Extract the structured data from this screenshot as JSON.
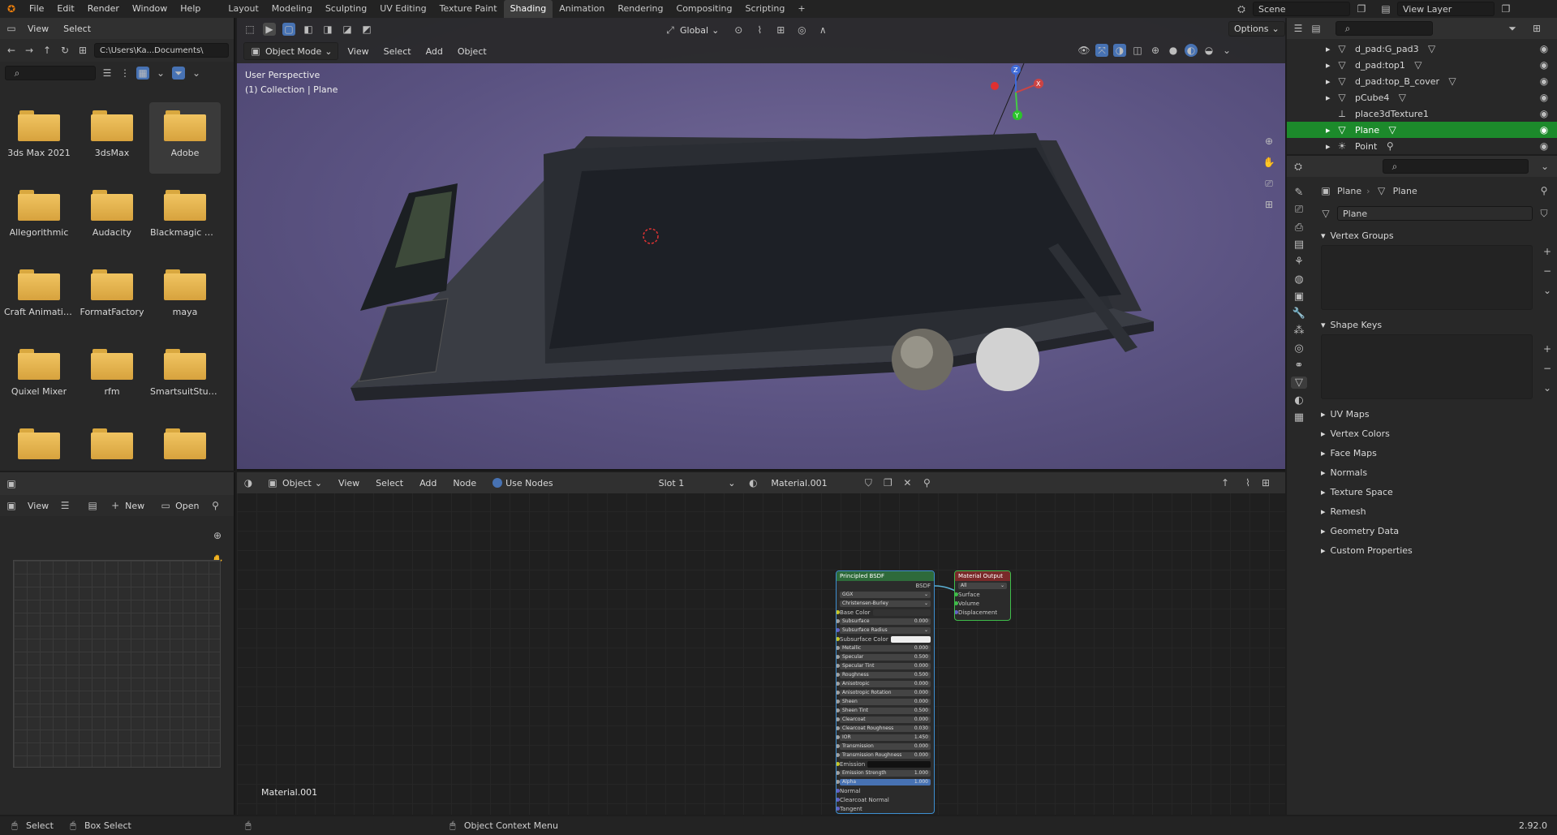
{
  "topbar": {
    "menus": [
      "File",
      "Edit",
      "Render",
      "Window",
      "Help"
    ],
    "workspaces": [
      "Layout",
      "Modeling",
      "Sculpting",
      "UV Editing",
      "Texture Paint",
      "Shading",
      "Animation",
      "Rendering",
      "Compositing",
      "Scripting"
    ],
    "active_workspace": "Shading",
    "add_tab": "+",
    "scene": "Scene",
    "view_layer": "View Layer"
  },
  "filebrowser": {
    "menus": [
      "View",
      "Select"
    ],
    "path": "C:\\Users\\Ka...Documents\\",
    "folders": [
      "3ds Max 2021",
      "3dsMax",
      "Adobe",
      "Allegorithmic",
      "Audacity",
      "Blackmagic De...",
      "Craft Animations",
      "FormatFactory",
      "maya",
      "Quixel Mixer",
      "rfm",
      "SmartsuitStudi...",
      "",
      "",
      ""
    ],
    "selected": "Adobe"
  },
  "imgeditor": {
    "view": "View",
    "new": "New",
    "open": "Open"
  },
  "viewport": {
    "mode": "Object Mode",
    "menus": [
      "View",
      "Select",
      "Add",
      "Object"
    ],
    "orientation": "Global",
    "options": "Options",
    "perspective": "User Perspective",
    "collection": "(1) Collection | Plane",
    "gizmo": {
      "x": "X",
      "y": "Y",
      "z": "Z"
    }
  },
  "nodeeditor": {
    "object": "Object",
    "menus": [
      "View",
      "Select",
      "Add",
      "Node"
    ],
    "use_nodes": "Use Nodes",
    "slot": "Slot 1",
    "material": "Material.001",
    "bottom_label": "Material.001",
    "bsdf": {
      "title": "Principled BSDF",
      "out": "BSDF",
      "dist": "GGX",
      "sss": "Christensen-Burley",
      "rows": [
        {
          "name": "Base Color",
          "val": ""
        },
        {
          "name": "Subsurface",
          "val": "0.000"
        },
        {
          "name": "Subsurface Radius",
          "val": ""
        },
        {
          "name": "Subsurface Color",
          "val": ""
        },
        {
          "name": "Metallic",
          "val": "0.000"
        },
        {
          "name": "Specular",
          "val": "0.500"
        },
        {
          "name": "Specular Tint",
          "val": "0.000"
        },
        {
          "name": "Roughness",
          "val": "0.500"
        },
        {
          "name": "Anisotropic",
          "val": "0.000"
        },
        {
          "name": "Anisotropic Rotation",
          "val": "0.000"
        },
        {
          "name": "Sheen",
          "val": "0.000"
        },
        {
          "name": "Sheen Tint",
          "val": "0.500"
        },
        {
          "name": "Clearcoat",
          "val": "0.000"
        },
        {
          "name": "Clearcoat Roughness",
          "val": "0.030"
        },
        {
          "name": "IOR",
          "val": "1.450"
        },
        {
          "name": "Transmission",
          "val": "0.000"
        },
        {
          "name": "Transmission Roughness",
          "val": "0.000"
        },
        {
          "name": "Emission",
          "val": ""
        },
        {
          "name": "Emission Strength",
          "val": "1.000"
        },
        {
          "name": "Alpha",
          "val": "1.000"
        },
        {
          "name": "Normal",
          "val": ""
        },
        {
          "name": "Clearcoat Normal",
          "val": ""
        },
        {
          "name": "Tangent",
          "val": ""
        }
      ]
    },
    "output": {
      "title": "Material Output",
      "target": "All",
      "rows": [
        "Surface",
        "Volume",
        "Displacement"
      ]
    }
  },
  "outliner": {
    "items": [
      {
        "name": "d_pad:G_pad3"
      },
      {
        "name": "d_pad:top1"
      },
      {
        "name": "d_pad:top_B_cover"
      },
      {
        "name": "pCube4"
      },
      {
        "name": "place3dTexture1"
      },
      {
        "name": "Plane"
      },
      {
        "name": "Point"
      }
    ],
    "selected": "Plane"
  },
  "props": {
    "breadcrumb_obj": "Plane",
    "breadcrumb_data": "Plane",
    "datablock": "Plane",
    "panels_open": [
      "Vertex Groups",
      "Shape Keys"
    ],
    "panels_closed": [
      "UV Maps",
      "Vertex Colors",
      "Face Maps",
      "Normals",
      "Texture Space",
      "Remesh",
      "Geometry Data",
      "Custom Properties"
    ]
  },
  "status": {
    "select": "Select",
    "box_select": "Box Select",
    "context_menu": "Object Context Menu",
    "version": "2.92.0"
  },
  "colors": {
    "accent_blue": "#4772b3",
    "selected_green": "#1c8a2b",
    "viewport_bg": "#5b5382"
  }
}
